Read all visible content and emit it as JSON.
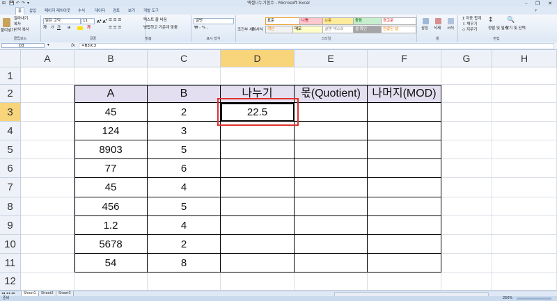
{
  "window": {
    "title": "엑셀나누기함수 - Microsoft Excel",
    "quick_access": [
      "⊞",
      "💾",
      "↶",
      "↷",
      "▾"
    ]
  },
  "tabs": [
    "홈",
    "삽입",
    "페이지 레이아웃",
    "수식",
    "데이터",
    "검토",
    "보기",
    "개발 도구"
  ],
  "ribbon": {
    "clipboard": {
      "label": "클립보드",
      "paste": "붙여넣기",
      "cut": "잘라내기",
      "copy": "복사",
      "format_painter": "서식 복사"
    },
    "font": {
      "label": "글꼴",
      "name": "맑은 고딕",
      "size": "11"
    },
    "alignment": {
      "label": "맞춤",
      "wrap": "텍스트 줄 바꿈",
      "merge": "병합하고 가운데 맞춤"
    },
    "number": {
      "label": "표시 형식",
      "format": "일반"
    },
    "styles": {
      "label": "스타일",
      "conditional": "조건부 서식",
      "as_table": "표 서식",
      "cells": [
        "표준",
        "나쁨",
        "보통",
        "좋음",
        "경고문",
        "계산",
        "메모",
        "설명 텍스트",
        "셀 확인",
        "연결된 셀"
      ]
    },
    "cells_group": {
      "label": "셀",
      "insert": "삽입",
      "delete": "삭제",
      "format": "서식"
    },
    "editing": {
      "label": "편집",
      "autosum": "자동 합계",
      "fill": "채우기",
      "clear": "지우기",
      "sort": "정렬 및 필터",
      "find": "찾기 및 선택"
    }
  },
  "formula_bar": {
    "name_box": "D3",
    "fx": "fx",
    "formula": "=B3/C3"
  },
  "columns": [
    "A",
    "B",
    "C",
    "D",
    "E",
    "F",
    "G",
    "H"
  ],
  "rows": [
    "1",
    "2",
    "3",
    "4",
    "5",
    "6",
    "7",
    "8",
    "9",
    "10",
    "11",
    "12"
  ],
  "selected": {
    "column": "D",
    "row": "3"
  },
  "table": {
    "headers": [
      "A",
      "B",
      "나누기",
      "몫(Quotient)",
      "나머지(MOD)"
    ],
    "rows": [
      [
        "45",
        "2",
        "22.5",
        "",
        ""
      ],
      [
        "124",
        "3",
        "",
        "",
        ""
      ],
      [
        "8903",
        "5",
        "",
        "",
        ""
      ],
      [
        "77",
        "6",
        "",
        "",
        ""
      ],
      [
        "45",
        "4",
        "",
        "",
        ""
      ],
      [
        "456",
        "5",
        "",
        "",
        ""
      ],
      [
        "1.2",
        "4",
        "",
        "",
        ""
      ],
      [
        "5678",
        "2",
        "",
        "",
        ""
      ],
      [
        "54",
        "8",
        "",
        "",
        ""
      ]
    ]
  },
  "sheets": [
    "Sheet1",
    "Sheet2",
    "Sheet3"
  ],
  "status": {
    "mode": "준비",
    "zoom": "250%"
  },
  "colors": {
    "header_fill": "#e4dff0",
    "selected_header": "#f8d47a",
    "highlight": "#e03030"
  }
}
